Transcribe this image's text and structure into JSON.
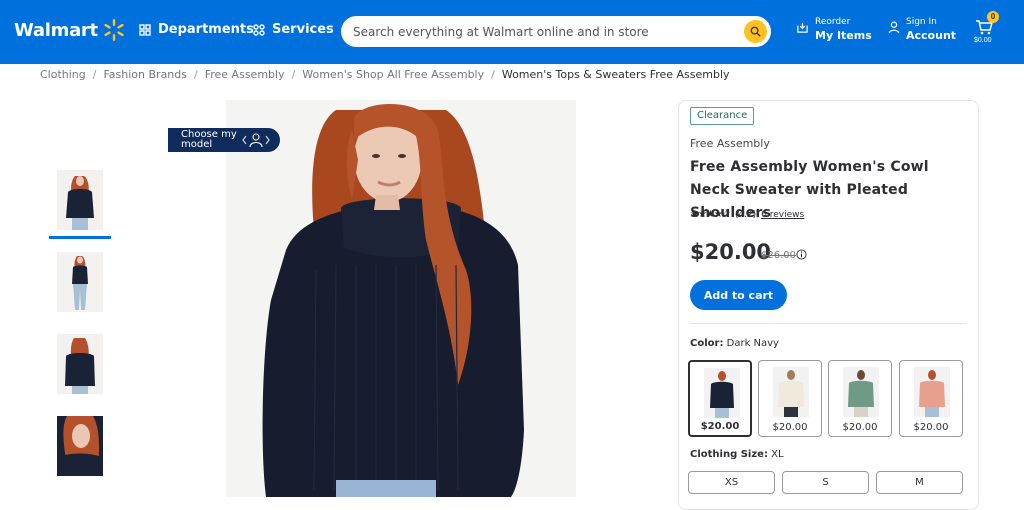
{
  "header": {
    "logo_text": "Walmart",
    "departments_label": "Departments",
    "services_label": "Services",
    "search_placeholder": "Search everything at Walmart online and in store",
    "reorder_small": "Reorder",
    "reorder_big": "My Items",
    "signin_small": "Sign In",
    "signin_big": "Account",
    "cart_count": "0",
    "cart_total": "$0.00",
    "colors": {
      "brand": "#0071dc",
      "spark": "#ffc220"
    }
  },
  "breadcrumb": [
    "Clothing",
    "Fashion Brands",
    "Free Assembly",
    "Women's Shop All Free Assembly",
    "Women's Tops & Sweaters Free Assembly"
  ],
  "gallery": {
    "choose_model_label": "Choose my model",
    "thumbnail_count": 4
  },
  "product": {
    "badge": "Clearance",
    "brand": "Free Assembly",
    "title": "Free Assembly Women's Cowl Neck Sweater with Pleated Shoulders",
    "rating_value": "(4.2)",
    "rating_stars": 4.2,
    "reviews_label": "6 reviews",
    "price": "$20.00",
    "was_price": "$26.00",
    "add_to_cart_label": "Add to cart",
    "color_label": "Color:",
    "color_value": "Dark Navy",
    "swatches": [
      {
        "price": "$20.00",
        "color": "#1a2235",
        "selected": true
      },
      {
        "price": "$20.00",
        "color": "#efeadc",
        "selected": false
      },
      {
        "price": "$20.00",
        "color": "#6f9a86",
        "selected": false
      },
      {
        "price": "$20.00",
        "color": "#e8a08e",
        "selected": false
      }
    ],
    "size_label": "Clothing Size:",
    "size_value": "XL",
    "sizes": [
      "XS",
      "S",
      "M"
    ]
  }
}
